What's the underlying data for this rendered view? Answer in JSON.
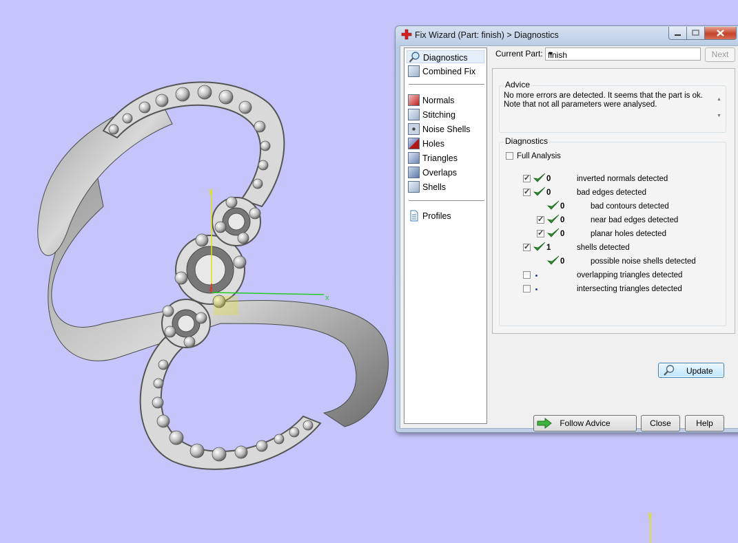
{
  "window": {
    "title": "Fix Wizard (Part: finish) > Diagnostics"
  },
  "nav": {
    "top": [
      {
        "label": "Diagnostics",
        "icon": "magnifier-icon"
      },
      {
        "label": "Combined Fix",
        "icon": "cube-icon"
      }
    ],
    "fixes": [
      {
        "label": "Normals",
        "icon": "normals-cube-icon"
      },
      {
        "label": "Stitching",
        "icon": "stitching-cube-icon"
      },
      {
        "label": "Noise Shells",
        "icon": "noise-shells-icon"
      },
      {
        "label": "Holes",
        "icon": "holes-cube-icon"
      },
      {
        "label": "Triangles",
        "icon": "triangles-cube-icon"
      },
      {
        "label": "Overlaps",
        "icon": "overlaps-cube-icon"
      },
      {
        "label": "Shells",
        "icon": "shells-cube-icon"
      }
    ],
    "bottom": [
      {
        "label": "Profiles",
        "icon": "document-icon"
      }
    ]
  },
  "part": {
    "label": "Current Part:",
    "value": "finish",
    "next_label": "Next"
  },
  "advice": {
    "title": "Advice",
    "line1": "No more errors are detected. It seems that the part is ok.",
    "line2": "Note that not all parameters were analysed."
  },
  "diagnostics": {
    "title": "Diagnostics",
    "full_analysis": "Full Analysis",
    "rows": [
      {
        "checkbox": true,
        "checked": true,
        "status": "ok",
        "count": "0",
        "label": "inverted normals detected"
      },
      {
        "checkbox": true,
        "checked": true,
        "status": "ok",
        "count": "0",
        "label": "bad edges detected"
      },
      {
        "checkbox": false,
        "checked": false,
        "status": "ok",
        "count": "0",
        "label": "bad contours detected"
      },
      {
        "checkbox": true,
        "checked": true,
        "status": "ok",
        "count": "0",
        "label": "near bad edges detected"
      },
      {
        "checkbox": true,
        "checked": true,
        "status": "ok",
        "count": "0",
        "label": "planar holes detected"
      },
      {
        "checkbox": true,
        "checked": true,
        "status": "ok",
        "count": "1",
        "label": "shells detected"
      },
      {
        "checkbox": false,
        "checked": false,
        "status": "ok",
        "count": "0",
        "label": "possible noise shells detected"
      },
      {
        "checkbox": true,
        "checked": false,
        "status": "pending",
        "count": "",
        "label": "overlapping triangles detected"
      },
      {
        "checkbox": true,
        "checked": false,
        "status": "pending",
        "count": "",
        "label": "intersecting triangles detected"
      }
    ],
    "update_label": "Update"
  },
  "buttons": {
    "follow_advice": "Follow Advice",
    "close": "Close",
    "help": "Help"
  },
  "viewport": {
    "axis_x": "x",
    "axis_y": "y",
    "axis_z": "z"
  },
  "colors": {
    "background": "#c5c5fb",
    "check_green": "#2e8b2e",
    "axis_y": "#e6e600",
    "axis_x": "#22cc22"
  }
}
